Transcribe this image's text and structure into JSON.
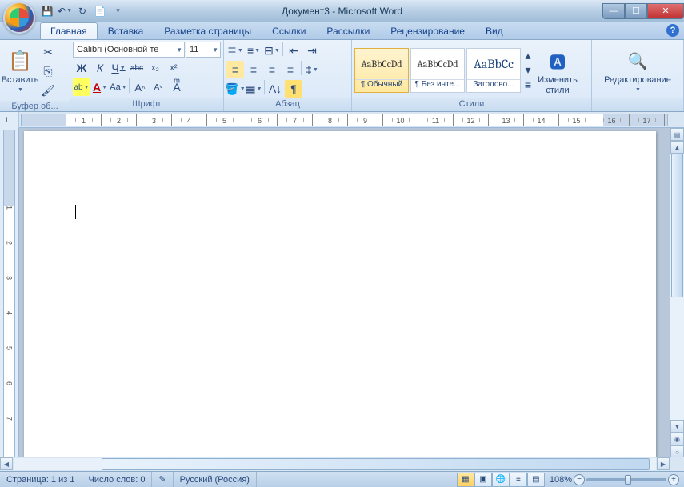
{
  "title": "Документ3 - Microsoft Word",
  "tabs": [
    "Главная",
    "Вставка",
    "Разметка страницы",
    "Ссылки",
    "Рассылки",
    "Рецензирование",
    "Вид"
  ],
  "active_tab": 0,
  "clipboard": {
    "paste": "Вставить",
    "group": "Буфер об..."
  },
  "font": {
    "name": "Calibri (Основной те",
    "size": "11",
    "group": "Шрифт",
    "bold": "Ж",
    "italic": "К",
    "underline": "Ч",
    "strike": "abc",
    "sub": "x₂",
    "sup": "x²",
    "highlight": "ab",
    "color": "A",
    "case": "Aa",
    "clear": "A",
    "grow": "A",
    "shrink": "A"
  },
  "para": {
    "group": "Абзац"
  },
  "styles": {
    "group": "Стили",
    "items": [
      {
        "preview": "AaBbCcDd",
        "name": "¶ Обычный",
        "sel": true
      },
      {
        "preview": "AaBbCcDd",
        "name": "¶ Без инте..."
      },
      {
        "preview": "AaBbCc",
        "name": "Заголово..."
      }
    ],
    "change": "Изменить стили"
  },
  "editing": {
    "label": "Редактирование"
  },
  "ruler_nums": [
    "1",
    "2",
    "3",
    "4",
    "5",
    "6",
    "7",
    "8",
    "9",
    "10",
    "11",
    "12",
    "13",
    "14",
    "15",
    "16",
    "17"
  ],
  "vruler_nums": [
    "1",
    "2",
    "3",
    "4",
    "5",
    "6",
    "7"
  ],
  "status": {
    "page": "Страница: 1 из 1",
    "words": "Число слов: 0",
    "lang": "Русский (Россия)",
    "zoom": "108%"
  }
}
